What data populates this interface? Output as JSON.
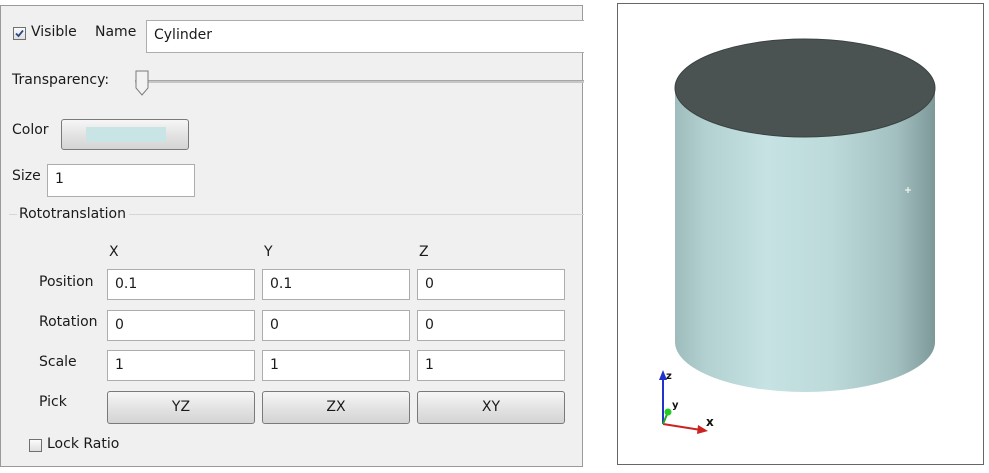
{
  "properties": {
    "visible_label": "Visible",
    "visible_checked": true,
    "name_label": "Name",
    "name_value": "Cylinder",
    "transparency_label": "Transparency:",
    "transparency_value": 0,
    "color_label": "Color",
    "color_swatch": "#c8e4e4",
    "size_label": "Size",
    "size_value": "1"
  },
  "rototranslation": {
    "title": "Rototranslation",
    "columns": [
      "X",
      "Y",
      "Z"
    ],
    "rows": [
      {
        "label": "Position",
        "values": [
          "0.1",
          "0.1",
          "0"
        ]
      },
      {
        "label": "Rotation",
        "values": [
          "0",
          "0",
          "0"
        ]
      },
      {
        "label": "Scale",
        "values": [
          "1",
          "1",
          "1"
        ]
      }
    ],
    "pick_label": "Pick",
    "pick_buttons": [
      "YZ",
      "ZX",
      "XY"
    ],
    "lock_ratio_label": "Lock Ratio",
    "lock_ratio_checked": false
  },
  "viewport": {
    "object_color": "#bcdcdc",
    "top_face_color": "#4a5252",
    "axes": {
      "x": "x",
      "y": "y",
      "z": "z"
    },
    "axis_colors": {
      "x": "#cc2222",
      "y": "#22aa22",
      "z": "#2233cc"
    }
  }
}
